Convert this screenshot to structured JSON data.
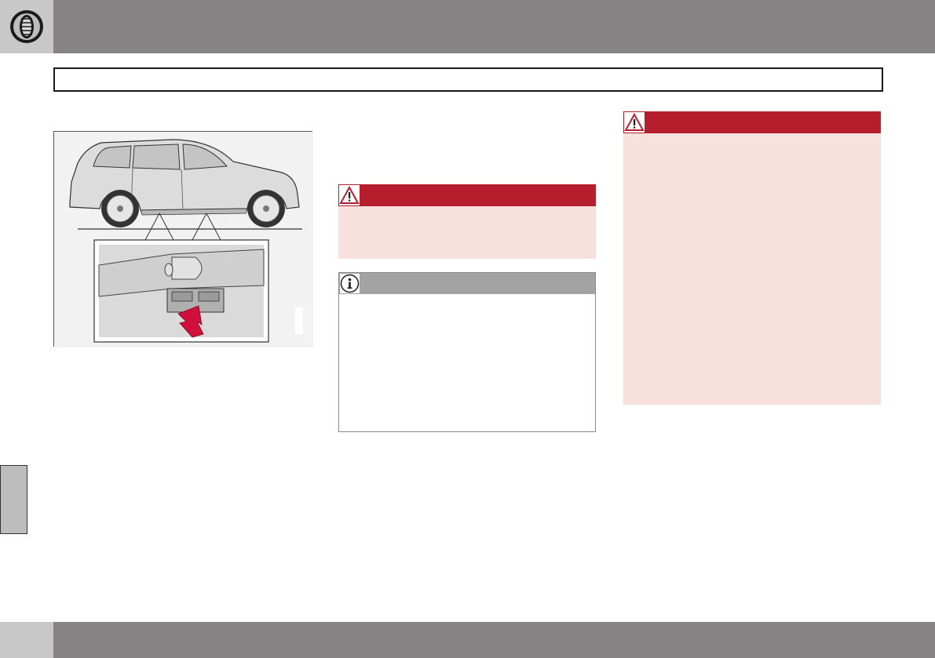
{
  "header": {
    "icon": "tire-icon",
    "section_title": ""
  },
  "figure": {
    "label": "I",
    "arrow_color": "#d0103a"
  },
  "warning_middle": {
    "icon": "warning-triangle-icon",
    "text": ""
  },
  "note": {
    "icon": "info-icon",
    "text": ""
  },
  "warning_right": {
    "icon": "warning-triangle-icon",
    "text": ""
  },
  "colors": {
    "header_gray": "#858383",
    "warning_red": "#b61e2e",
    "warning_bg": "#f6e1dc",
    "note_gray": "#a3a3a3"
  }
}
